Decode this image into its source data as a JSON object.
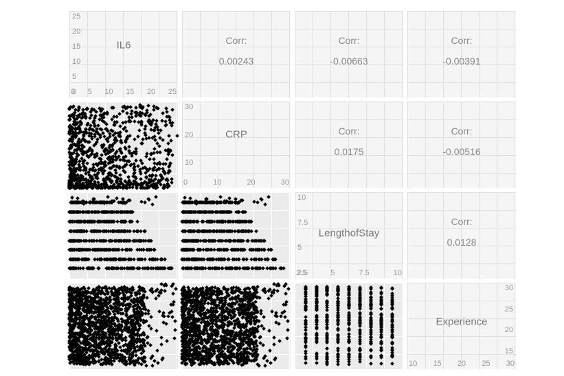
{
  "chart_data": {
    "type": "scatter",
    "description": "Pairwise correlation/scatter matrix (ggpairs-style) of 4 variables",
    "variables": [
      "IL6",
      "CRP",
      "LengthofStay",
      "Experience"
    ],
    "corr_label": "Corr:",
    "correlations": {
      "IL6_CRP": "0.00243",
      "IL6_LengthofStay": "-0.00663",
      "IL6_Experience": "-0.00391",
      "CRP_LengthofStay": "0.0175",
      "CRP_Experience": "-0.00516",
      "LengthofStay_Experience": "0.0128"
    },
    "axes": {
      "IL6": {
        "ticks": [
          "0",
          "5",
          "10",
          "15",
          "20",
          "25"
        ],
        "range": [
          0,
          25
        ]
      },
      "CRP": {
        "ticks": [
          "0",
          "10",
          "20",
          "30"
        ],
        "range": [
          0,
          30
        ]
      },
      "LengthofStay": {
        "ticks": [
          "2.5",
          "5",
          "7.5",
          "10"
        ],
        "range": [
          2,
          10
        ]
      },
      "Experience": {
        "ticks": [
          "10",
          "15",
          "20",
          "25",
          "30"
        ],
        "range": [
          10,
          30
        ]
      }
    },
    "scatter_panels": [
      {
        "x": "IL6",
        "y": "CRP",
        "shape": "dense-lowerleft"
      },
      {
        "x": "IL6",
        "y": "LengthofStay",
        "shape": "horizontal-bands"
      },
      {
        "x": "CRP",
        "y": "LengthofStay",
        "shape": "horizontal-bands"
      },
      {
        "x": "IL6",
        "y": "Experience",
        "shape": "dense-block"
      },
      {
        "x": "CRP",
        "y": "Experience",
        "shape": "dense-block"
      },
      {
        "x": "LengthofStay",
        "y": "Experience",
        "shape": "vertical-bands"
      }
    ]
  }
}
